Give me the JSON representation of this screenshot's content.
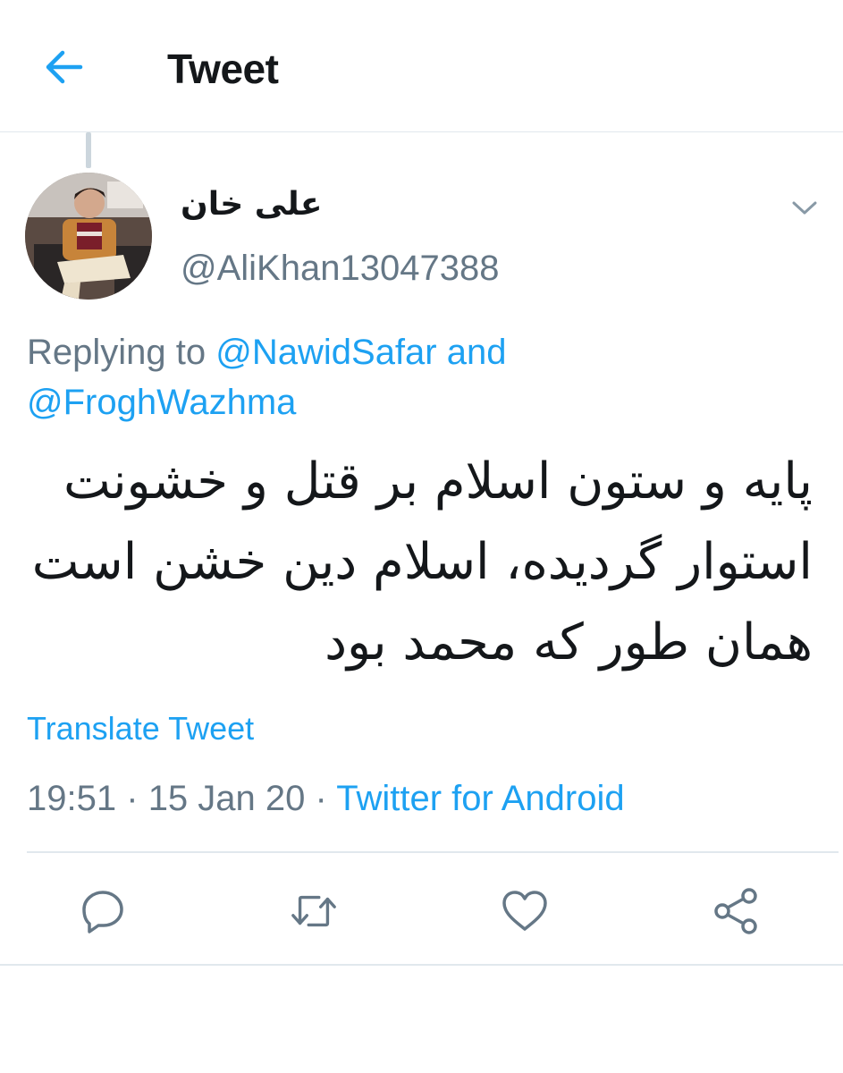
{
  "header": {
    "title": "Tweet",
    "back_icon": "arrow-left-icon"
  },
  "colors": {
    "accent": "#1da1f2",
    "secondary_text": "#657786",
    "primary_text": "#14171a",
    "border": "#e1e8ed"
  },
  "tweet": {
    "author": {
      "display_name": "علی خان",
      "handle": "@AliKhan13047388"
    },
    "reply": {
      "prefix": "Replying to",
      "mention_1": "@NawidSafar",
      "conjunction": "and",
      "mention_2": "@FroghWazhma"
    },
    "text_lines": [
      "پایه و ستون اسلام بر قتل و خشونت",
      "استوار گردیده، اسلام دین خشن است",
      "همان طور که محمد بود"
    ],
    "translate_label": "Translate Tweet",
    "time": "19:51",
    "separator": "·",
    "date": "15 Jan 20",
    "source": "Twitter for Android"
  },
  "actions": [
    "reply-icon",
    "retweet-icon",
    "like-icon",
    "share-icon"
  ]
}
